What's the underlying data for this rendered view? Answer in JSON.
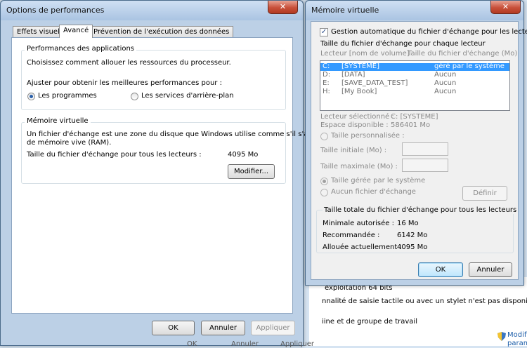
{
  "background": {
    "lines": [
      "exploitation 64 bits",
      "nnalité de saisie tactile ou avec un stylet n'est pas disponible s",
      "iine et de groupe de travail",
      "Modifi",
      "param"
    ]
  },
  "perf": {
    "title": "Options de performances",
    "close": "✕",
    "tabs": [
      "Effets visuels",
      "Avancé",
      "Prévention de l'exécution des données"
    ],
    "perf_group": {
      "title": "Performances des applications",
      "desc": "Choisissez comment allouer les ressources du processeur.",
      "adjust": "Ajuster pour obtenir les meilleures performances pour :",
      "opt_programs": "Les programmes",
      "opt_services": "Les services d'arrière-plan"
    },
    "vm_group": {
      "title": "Mémoire virtuelle",
      "desc1": "Un fichier d'échange est une zone du disque que Windows utilise comme s'il s'agissait",
      "desc2": "de mémoire vive (RAM).",
      "size_label": "Taille du fichier d'échange pour tous les lecteurs :",
      "size_value": "4095 Mo",
      "modify": "Modifier..."
    },
    "buttons": {
      "ok": "OK",
      "cancel": "Annuler",
      "apply": "Appliquer"
    },
    "behind": {
      "ok": "OK",
      "cancel": "Annuler",
      "apply": "Appliquer"
    }
  },
  "vm": {
    "title": "Mémoire virtuelle",
    "close": "✕",
    "auto_manage": "Gestion automatique du fichier d'échange pour les lecteurs",
    "per_drive_title": "Taille du fichier d'échange pour chaque lecteur",
    "col_drive": "Lecteur [nom de volume]",
    "col_size": "Taille du fichier d'échange (Mo)",
    "drives": [
      {
        "letter": "C:",
        "name": "[SYSTEME]",
        "size": "géré par le système",
        "selected": true
      },
      {
        "letter": "D:",
        "name": "[DATA]",
        "size": "Aucun",
        "selected": false
      },
      {
        "letter": "E:",
        "name": "[SAVE_DATA_TEST]",
        "size": "Aucun",
        "selected": false
      },
      {
        "letter": "H:",
        "name": "[My Book]",
        "size": "Aucun",
        "selected": false
      }
    ],
    "selected_drive_label": "Lecteur sélectionné :",
    "selected_drive_value": "C:  [SYSTEME]",
    "free_space_label": "Espace disponible :",
    "free_space_value": "586401 Mo",
    "custom_size": "Taille personnalisée :",
    "initial_size": "Taille initiale (Mo) :",
    "max_size": "Taille maximale (Mo) :",
    "system_managed": "Taille gérée par le système",
    "no_paging": "Aucun fichier d'échange",
    "define": "Définir",
    "total_title": "Taille totale du fichier d'échange pour tous les lecteurs",
    "min_label": "Minimale autorisée :",
    "min_value": "16 Mo",
    "rec_label": "Recommandée :",
    "rec_value": "6142 Mo",
    "alloc_label": "Allouée actuellement :",
    "alloc_value": "4095 Mo",
    "ok": "OK",
    "cancel": "Annuler"
  }
}
